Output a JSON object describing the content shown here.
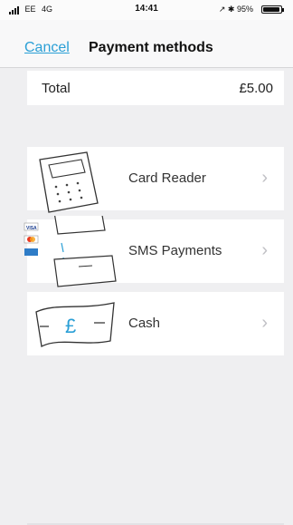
{
  "status_bar": {
    "carrier": "EE",
    "network": "4G",
    "time": "14:41",
    "battery": "95%",
    "battery_level": 0.95
  },
  "nav": {
    "cancel_label": "Cancel",
    "title": "Payment methods"
  },
  "total": {
    "label": "Total",
    "value": "£5.00"
  },
  "methods": [
    {
      "label": "Card Reader",
      "icon": "card-reader-icon"
    },
    {
      "label": "SMS Payments",
      "icon": "sms-payments-icon"
    },
    {
      "label": "Cash",
      "icon": "cash-icon"
    }
  ],
  "sms_logo_text": "VISA",
  "cash_symbol": "£",
  "colors": {
    "accent": "#2a9fd6",
    "background": "#efeff1",
    "row": "#ffffff"
  }
}
